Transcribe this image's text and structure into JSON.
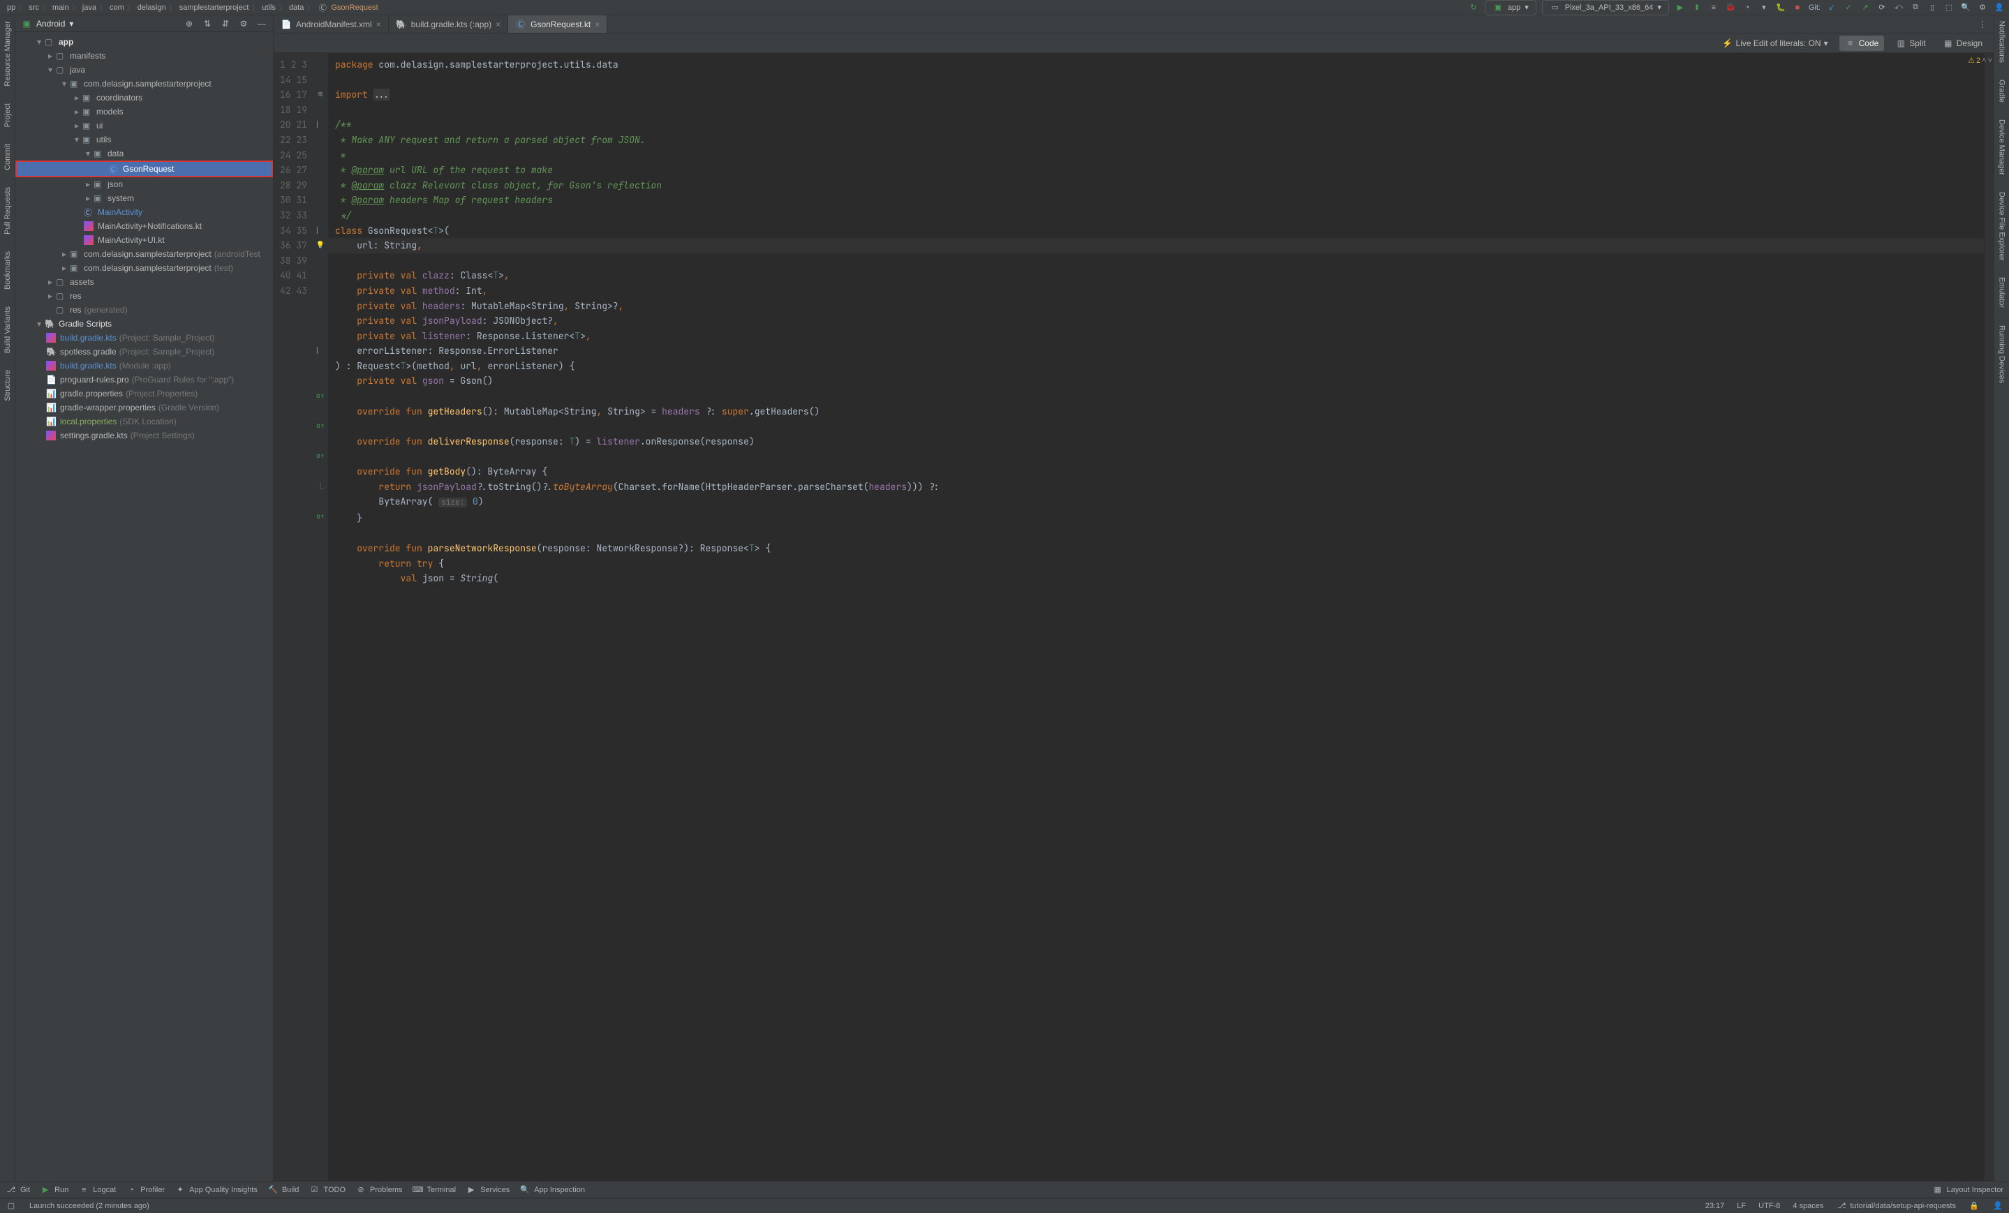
{
  "breadcrumbs": [
    "pp",
    "src",
    "main",
    "java",
    "com",
    "delasign",
    "samplestarterproject",
    "utils",
    "data"
  ],
  "breadcrumb_active": "GsonRequest",
  "run_config": "app",
  "device_selector": "Pixel_3a_API_33_x86_64",
  "git_label": "Git:",
  "panel": {
    "title": "Android"
  },
  "tree": {
    "app": "app",
    "manifests": "manifests",
    "java": "java",
    "pkg1": "com.delasign.samplestarterproject",
    "coordinators": "coordinators",
    "models": "models",
    "ui": "ui",
    "utils": "utils",
    "data": "data",
    "gsonrequest": "GsonRequest",
    "json": "json",
    "system": "system",
    "mainactivity": "MainActivity",
    "mainactivity_notifications": "MainActivity+Notifications.kt",
    "mainactivity_ui": "MainActivity+UI.kt",
    "pkg_androidtest_name": "com.delasign.samplestarterproject",
    "pkg_androidtest_note": "(androidTest",
    "pkg_test_name": "com.delasign.samplestarterproject",
    "pkg_test_note": "(test)",
    "assets": "assets",
    "res": "res",
    "res_generated": "res",
    "res_generated_note": "(generated)",
    "gradle_scripts": "Gradle Scripts",
    "bg1": "build.gradle.kts",
    "bg1_note": "(Project: Sample_Project)",
    "spotless": "spotless.gradle",
    "spotless_note": "(Project: Sample_Project)",
    "bg2": "build.gradle.kts",
    "bg2_note": "(Module :app)",
    "proguard": "proguard-rules.pro",
    "proguard_note": "(ProGuard Rules for \":app\")",
    "gp": "gradle.properties",
    "gp_note": "(Project Properties)",
    "gwp": "gradle-wrapper.properties",
    "gwp_note": "(Gradle Version)",
    "lp": "local.properties",
    "lp_note": "(SDK Location)",
    "sg": "settings.gradle.kts",
    "sg_note": "(Project Settings)"
  },
  "tabs": {
    "t1": "AndroidManifest.xml",
    "t2": "build.gradle.kts (:app)",
    "t3": "GsonRequest.kt"
  },
  "subbar": {
    "live_edit": "Live Edit of literals: ON",
    "code": "Code",
    "split": "Split",
    "design": "Design"
  },
  "side_tools": {
    "left": [
      "Resource Manager",
      "Project",
      "Commit",
      "Pull Requests",
      "Bookmarks",
      "Build Variants",
      "Structure"
    ],
    "right": [
      "Notifications",
      "Gradle",
      "Device Manager",
      "Device File Explorer",
      "Emulator",
      "Running Devices"
    ]
  },
  "code": {
    "l1": "package com.delasign.samplestarterproject.utils.data",
    "l3a": "import",
    "l3b": "...",
    "l5": "/**",
    "l6": " * Make ANY request and return a parsed object from JSON.",
    "l7": " *",
    "l8a": " * ",
    "l8tag": "@param",
    "l8b": " url URL of the request to make",
    "l9a": " * ",
    "l9tag": "@param",
    "l9b": " clazz Relevant class object, for Gson's reflection",
    "l10a": " * ",
    "l10tag": "@param",
    "l10b": " headers Map of request headers",
    "l11": " */",
    "l12": "class GsonRequest<T>(",
    "l13": "    url: String,",
    "l14": "    private val clazz: Class<T>,",
    "l15": "    private val method: Int,",
    "l16": "    private val headers: MutableMap<String, String>?,",
    "l17": "    private val jsonPayload: JSONObject?,",
    "l18": "    private val listener: Response.Listener<T>,",
    "l19": "    errorListener: Response.ErrorListener",
    "l20": ") : Request<T>(method, url, errorListener) {",
    "l21": "    private val gson = Gson()",
    "l23": "    override fun getHeaders(): MutableMap<String, String> = headers ?: super.getHeaders()",
    "l25": "    override fun deliverResponse(response: T) = listener.onResponse(response)",
    "l27": "    override fun getBody(): ByteArray {",
    "l28a": "        return jsonPayload?.toString()?.",
    "l28b": "toByteArray",
    "l28c": "(Charset.forName(HttpHeaderParser.parseCharset(headers))) ?:",
    "l29a": "        ByteArray( ",
    "l29hint": "size:",
    "l29b": " 0)",
    "l30": "    }",
    "l32": "    override fun parseNetworkResponse(response: NetworkResponse?): Response<T> {",
    "l33": "        return try {",
    "l34": "            val json = String("
  },
  "warnings": {
    "count": "2"
  },
  "bottom_tools": {
    "git": "Git",
    "run": "Run",
    "logcat": "Logcat",
    "profiler": "Profiler",
    "quality": "App Quality Insights",
    "build": "Build",
    "todo": "TODO",
    "problems": "Problems",
    "terminal": "Terminal",
    "services": "Services",
    "app_inspection": "App Inspection",
    "layout_inspector": "Layout Inspector"
  },
  "status": {
    "message": "Launch succeeded (2 minutes ago)",
    "cursor": "23:17",
    "lf": "LF",
    "encoding": "UTF-8",
    "indent": "4 spaces",
    "branch": "tutorial/data/setup-api-requests"
  }
}
